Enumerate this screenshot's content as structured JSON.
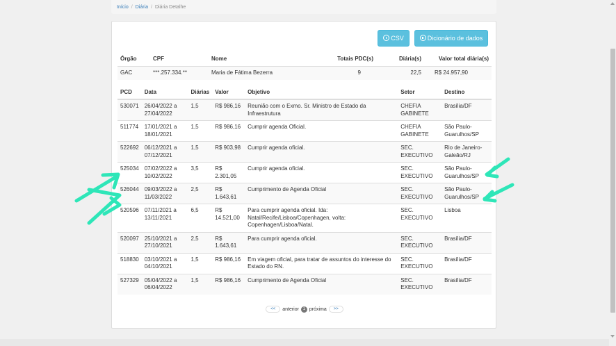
{
  "breadcrumb": {
    "items": [
      "Início",
      "Diária"
    ],
    "current": "Diária Detalhe"
  },
  "buttons": {
    "csv": "CSV",
    "dictionary": "Dicionário de dados"
  },
  "summary": {
    "headers": [
      "Órgão",
      "CPF",
      "Nome",
      "Totais PDC(s)",
      "Diária(s)",
      "Valor total diária(s)"
    ],
    "row": [
      "GAC",
      "***.257.334.**",
      "Maria de Fátima Bezerra",
      "9",
      "22,5",
      "R$ 24.957,90"
    ]
  },
  "details": {
    "headers": [
      "PCD",
      "Data",
      "Diárias",
      "Valor",
      "Objetivo",
      "Setor",
      "Destino"
    ],
    "rows": [
      [
        "530071",
        "26/04/2022 a 27/04/2022",
        "1,5",
        "R$ 986,16",
        "Reunião com o Exmo. Sr. Ministro de Estado da Infraestrutura",
        "CHEFIA GABINETE",
        "Brasília/DF"
      ],
      [
        "511774",
        "17/01/2021 a 18/01/2021",
        "1,5",
        "R$ 986,16",
        "Cumprir agenda Oficial.",
        "CHEFIA GABINETE",
        "São Paulo-Guarulhos/SP"
      ],
      [
        "522692",
        "06/12/2021 a 07/12/2021",
        "1,5",
        "R$ 903,98",
        "Cumprir agenda oficial.",
        "SEC. EXECUTIVO",
        "Rio de Janeiro-Galeão/RJ"
      ],
      [
        "525034",
        "07/02/2022 a 10/02/2022",
        "3,5",
        "R$ 2.301,05",
        "Cumprir agenda oficial.",
        "SEC. EXECUTIVO",
        "São Paulo-Guarulhos/SP"
      ],
      [
        "526044",
        "09/03/2022 a 11/03/2022",
        "2,5",
        "R$ 1.643,61",
        "Cumprimento de Agenda Oficial",
        "SEC. EXECUTIVO",
        "São Paulo-Guarulhos/SP"
      ],
      [
        "520596",
        "07/11/2021 a 13/11/2021",
        "6,5",
        "R$ 14.521,00",
        "Para cumprir agenda oficial. Ida: Natal/Recife/Lisboa/Copenhagen, volta: Copenhagen/Lisboa/Natal.",
        "SEC. EXECUTIVO",
        "Lisboa"
      ],
      [
        "520097",
        "25/10/2021 a 27/10/2021",
        "2,5",
        "R$ 1.643,61",
        "Para cumprir agenda oficial.",
        "SEC. EXECUTIVO",
        "Brasília/DF"
      ],
      [
        "518830",
        "03/10/2021 a 04/10/2021",
        "1,5",
        "R$ 986,16",
        "Em viagem oficial, para tratar de assuntos do interesse do Estado do RN.",
        "SEC. EXECUTIVO",
        "Brasília/DF"
      ],
      [
        "527329",
        "05/04/2022 a 06/04/2022",
        "1,5",
        "R$ 986,16",
        "Cumprimento de Agenda Oficial",
        "SEC. EXECUTIVO",
        "Brasília/DF"
      ]
    ]
  },
  "pagination": {
    "first": "<<",
    "prev": "anterior",
    "current": "1",
    "next": "próxima",
    "last": ">>"
  },
  "colors": {
    "accent": "#5bc0de",
    "link": "#337ab7",
    "annotation": "#2ee6b8"
  }
}
